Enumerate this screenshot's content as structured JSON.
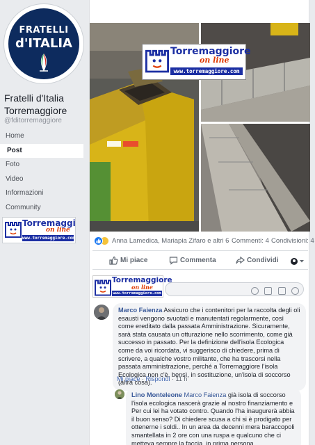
{
  "sidebar": {
    "logo_text_line1": "FRATELLI",
    "logo_text_line2": "d'ITALIA",
    "page_name": "Fratelli d'Italia Torremaggiore",
    "handle": "@fditorremaggiore",
    "nav": [
      {
        "label": "Home"
      },
      {
        "label": "Post",
        "active": true
      },
      {
        "label": "Foto"
      },
      {
        "label": "Video"
      },
      {
        "label": "Informazioni"
      },
      {
        "label": "Community"
      }
    ]
  },
  "torremaggiore_logo": {
    "title": "Torremaggiore",
    "subtitle": "on line",
    "url": "www.torremaggiore.com"
  },
  "post": {
    "reactions": {
      "names": "Anna Lamedica, Mariapia Zifaro e altri 6",
      "comments": "Commenti: 4",
      "shares": "Condivisioni: 4"
    },
    "actions": {
      "like": "Mi piace",
      "comment": "Commenta",
      "share": "Condividi"
    }
  },
  "comments": [
    {
      "author": "Marco Faienza",
      "text": "Assicuro che i contenitori per la raccolta degli oli esausti vengono svuotati e manutentati regolarmente, così come ereditato dalla passata Amministrazione. Sicuramente, sarà stata causata un otturazione nello scorrimento, come già successo in passato. Per la definizione dell'isola Ecologica come da voi ricordata, vi suggerisco di chiedere, prima di scrivere, a qualche vostro militante, che ha trascorsi nella passata amministrazione, perché a Torremaggiore l'isola Ecologica non c'è, bensì, in sostituzione, un'isola di soccorso (altra cosa).",
      "like": "Mi piace",
      "reply": "Rispondi",
      "time": "11 h"
    },
    {
      "author": "Lino Monteleone",
      "mention": "Marco Faienza",
      "text": "già isola di soccorso l'isola ecologica nascerà grazie al nostro finanziamento e Per cui lei ha votato contro. Quando l'ha inaugurerà abbia il buon senso? Di chiedere scusa a chi si è prodigato per ottenerne i soldi.. In un area da decenni mera baraccopoli smantellata in 2 ore con una ruspa e qualcuno che ci metteva sempre la faccia, in prima persona."
    }
  ],
  "colors": {
    "link": "#385898",
    "like_blue": "#1877f2",
    "logo_navy": "#0d2b5e",
    "tm_blue": "#1c2fa3",
    "tm_orange": "#e03a00"
  }
}
